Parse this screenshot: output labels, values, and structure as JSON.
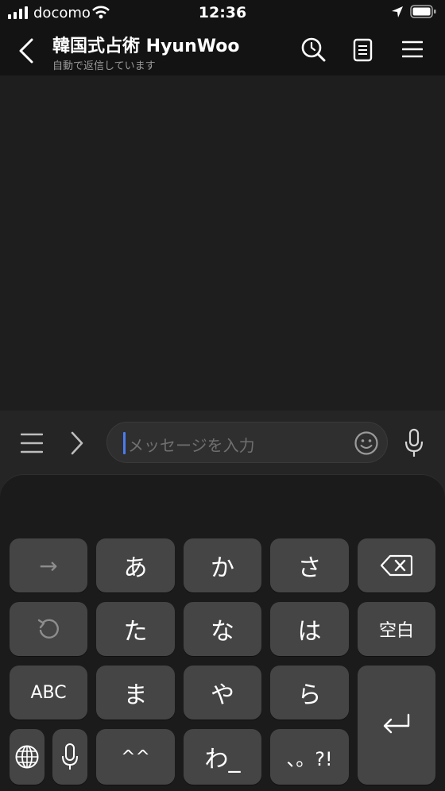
{
  "status_bar": {
    "carrier": "docomo",
    "time": "12:36"
  },
  "header": {
    "title": "韓国式占術 HyunWoo",
    "subtitle": "自動で返信しています"
  },
  "composer": {
    "placeholder": "メッセージを入力"
  },
  "keyboard": {
    "row1": [
      "→",
      "あ",
      "か",
      "さ"
    ],
    "row2": [
      "た",
      "な",
      "は",
      "空白"
    ],
    "row3": [
      "ABC",
      "ま",
      "や",
      "ら"
    ],
    "row4": [
      "^^",
      "わ_",
      "、。?!"
    ]
  },
  "colors": {
    "background": "#1d1d1d",
    "bar": "#131313",
    "key": "#454545",
    "caret": "#4a7cf0"
  }
}
